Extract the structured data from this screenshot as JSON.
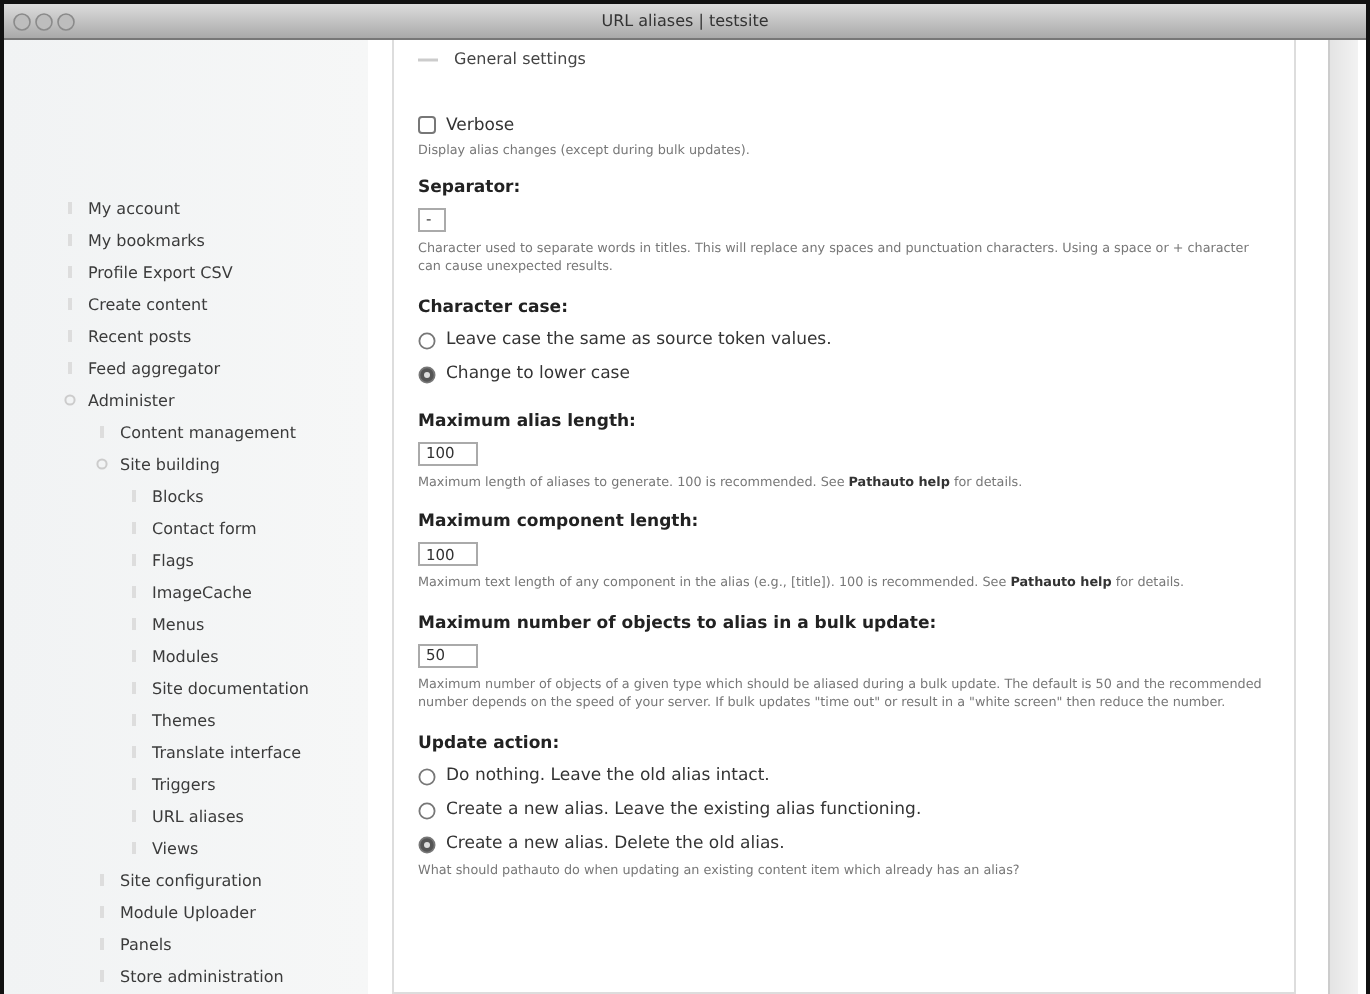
{
  "window": {
    "title": "URL aliases | testsite"
  },
  "sidebar": {
    "items": [
      {
        "label": "My account"
      },
      {
        "label": "My bookmarks"
      },
      {
        "label": "Profile Export CSV"
      },
      {
        "label": "Create content"
      },
      {
        "label": "Recent posts"
      },
      {
        "label": "Feed aggregator"
      },
      {
        "label": "Administer",
        "children": [
          {
            "label": "Content management"
          },
          {
            "label": "Site building",
            "children": [
              {
                "label": "Blocks"
              },
              {
                "label": "Contact form"
              },
              {
                "label": "Flags"
              },
              {
                "label": "ImageCache"
              },
              {
                "label": "Menus"
              },
              {
                "label": "Modules"
              },
              {
                "label": "Site documentation"
              },
              {
                "label": "Themes"
              },
              {
                "label": "Translate interface"
              },
              {
                "label": "Triggers"
              },
              {
                "label": "URL aliases"
              },
              {
                "label": "Views"
              }
            ]
          },
          {
            "label": "Site configuration"
          },
          {
            "label": "Module Uploader"
          },
          {
            "label": "Panels"
          },
          {
            "label": "Store administration"
          }
        ]
      }
    ]
  },
  "fieldset": {
    "legend": "General settings",
    "expanded": true,
    "settings": [
      {
        "kind": "checkbox",
        "label": "Verbose",
        "checked": false,
        "description": {
          "text": "Display alias changes (except during bulk updates)."
        }
      },
      {
        "kind": "textfield",
        "label": "Separator:",
        "value": "-",
        "description": {
          "text": "Character used to separate words in titles. This will replace any spaces and punctuation characters. Using a space or + character can cause unexpected results."
        }
      },
      {
        "kind": "radios",
        "label": "Character case:",
        "options": [
          {
            "label": "Leave case the same as source token values.",
            "selected": false
          },
          {
            "label": "Change to lower case",
            "selected": true
          }
        ]
      },
      {
        "kind": "textfield",
        "label": "Maximum alias length:",
        "value": "100",
        "description": {
          "text": "Maximum length of aliases to generate. 100 is recommended. See",
          "link": "Pathauto help",
          "after": "for details."
        }
      },
      {
        "kind": "textfield",
        "label": "Maximum component length:",
        "value": "100",
        "description": {
          "text": "Maximum text length of any component in the alias (e.g., [title]). 100 is recommended. See",
          "link": "Pathauto help",
          "after": "for details."
        }
      },
      {
        "kind": "textfield",
        "label": "Maximum number of objects to alias in a bulk update:",
        "value": "50",
        "description": {
          "text": "Maximum number of objects of a given type which should be aliased during a bulk update. The default is 50 and the recommended number depends on the speed of your server. If bulk updates \"time out\" or result in a \"white screen\" then reduce the number."
        }
      },
      {
        "kind": "radios",
        "label": "Update action:",
        "options": [
          {
            "label": "Do nothing. Leave the old alias intact.",
            "selected": false
          },
          {
            "label": "Create a new alias. Leave the existing alias functioning.",
            "selected": false
          },
          {
            "label": "Create a new alias. Delete the old alias.",
            "selected": true
          }
        ],
        "description": {
          "text": "What should pathauto do when updating an existing content item which already has an alias?"
        }
      }
    ]
  }
}
